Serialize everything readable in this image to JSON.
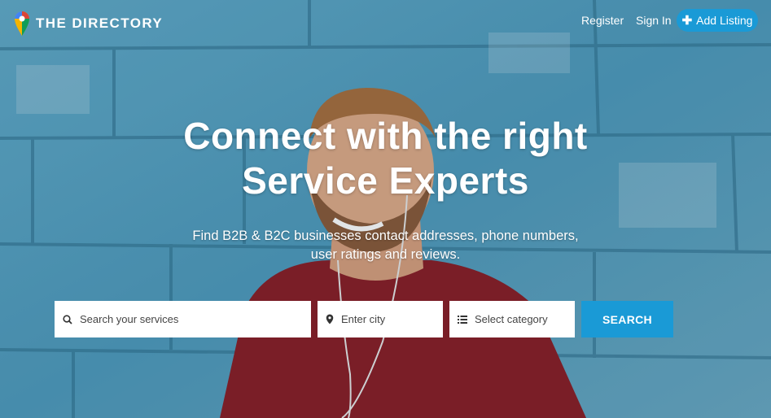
{
  "brand": {
    "name": "THE DIRECTORY",
    "icon": "map-pin-logo-icon"
  },
  "nav": {
    "register": "Register",
    "signin": "Sign In",
    "add_listing": "Add Listing",
    "add_icon": "plus-icon"
  },
  "hero": {
    "headline_line1": "Connect with the right",
    "headline_line2": "Service Experts",
    "sub_line1": "Find B2B & B2C businesses contact addresses, phone numbers,",
    "sub_line2": "user ratings and reviews."
  },
  "search": {
    "service_placeholder": "Search your services",
    "city_placeholder": "Enter city",
    "category_placeholder": "Select category",
    "button": "SEARCH"
  },
  "colors": {
    "accent": "#1a9ad6",
    "wall": "#5aa3c2",
    "shirt": "#8a1e26"
  }
}
